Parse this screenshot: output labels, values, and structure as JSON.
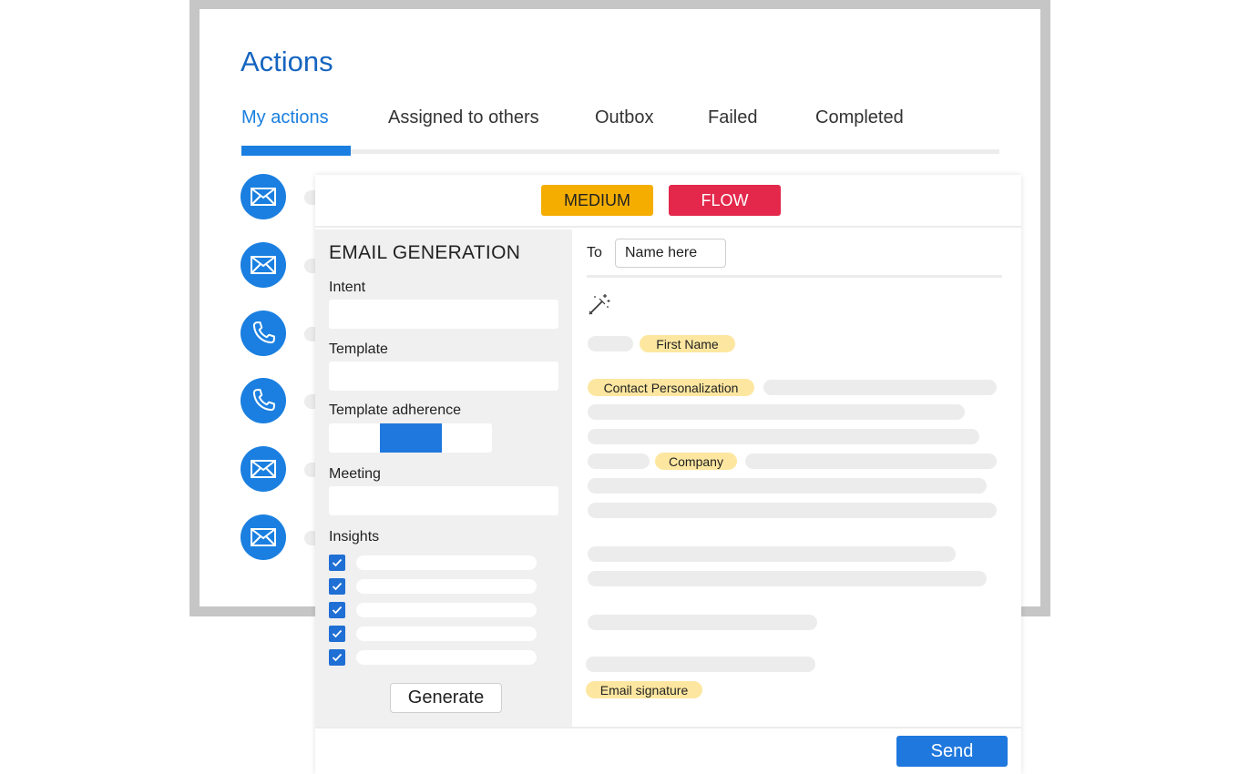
{
  "actions_window": {
    "title": "Actions",
    "tabs": [
      {
        "label": "My actions",
        "active": true
      },
      {
        "label": "Assigned to others",
        "active": false
      },
      {
        "label": "Outbox",
        "active": false
      },
      {
        "label": "Failed",
        "active": false
      },
      {
        "label": "Completed",
        "active": false
      }
    ],
    "action_items": [
      {
        "icon": "envelope-icon"
      },
      {
        "icon": "envelope-icon"
      },
      {
        "icon": "phone-icon"
      },
      {
        "icon": "phone-icon"
      },
      {
        "icon": "envelope-icon"
      },
      {
        "icon": "envelope-icon"
      }
    ]
  },
  "card": {
    "tags": {
      "medium": "MEDIUM",
      "flow": "FLOW"
    },
    "left": {
      "title": "EMAIL GENERATION",
      "intent_label": "Intent",
      "template_label": "Template",
      "adherence_label": "Template adherence",
      "adherence_level": 0.5,
      "meeting_label": "Meeting",
      "insights_label": "Insights",
      "insights_checked": [
        true,
        true,
        true,
        true,
        true
      ],
      "generate_label": "Generate"
    },
    "right": {
      "to_label": "To",
      "to_placeholder": "Name here",
      "vars": {
        "first_name": "First Name",
        "contact_personalization": "Contact Personalization",
        "company": "Company",
        "signature": "Email signature"
      },
      "icon": "magic-wand-icon"
    },
    "send_label": "Send"
  },
  "colors": {
    "accent": "#1a7fe0",
    "title_blue": "#1565c0",
    "medium_tag": "#f5ae00",
    "flow_tag": "#e3284b",
    "variable_chip": "#fde7a0"
  }
}
